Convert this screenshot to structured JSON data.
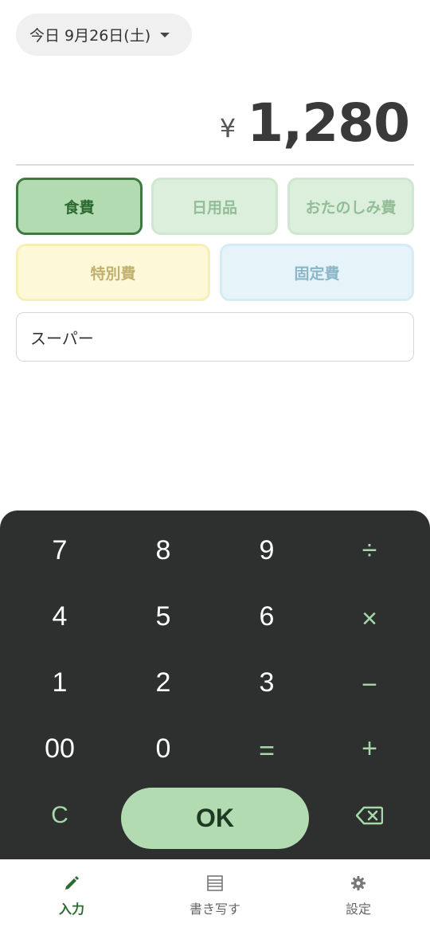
{
  "header": {
    "date_label": "今日 9月26日(土)"
  },
  "amount": {
    "currency": "¥",
    "value": "1,280"
  },
  "categories": [
    {
      "label": "食費",
      "selected": true,
      "color": "#b2dbb2"
    },
    {
      "label": "日用品",
      "selected": false,
      "color": "#dcefdc"
    },
    {
      "label": "おたのしみ費",
      "selected": false,
      "color": "#dcefdc"
    },
    {
      "label": "特別費",
      "selected": false,
      "color": "#fdf8d8"
    },
    {
      "label": "固定費",
      "selected": false,
      "color": "#e6f3f9"
    }
  ],
  "memo": {
    "value": "スーパー"
  },
  "keypad": {
    "keys": [
      "7",
      "8",
      "9",
      "÷",
      "4",
      "5",
      "6",
      "×",
      "1",
      "2",
      "3",
      "−",
      "00",
      "0",
      "=",
      "+",
      "C"
    ],
    "ok_label": "OK",
    "backspace_icon": "backspace-icon"
  },
  "nav": {
    "items": [
      {
        "label": "入力",
        "icon": "pencil-icon",
        "active": true
      },
      {
        "label": "書き写す",
        "icon": "list-icon",
        "active": false
      },
      {
        "label": "設定",
        "icon": "gear-icon",
        "active": false
      }
    ]
  },
  "colors": {
    "accent": "#2d6a31",
    "keypad_bg": "#2e3030",
    "operator": "#a5d9a8"
  }
}
